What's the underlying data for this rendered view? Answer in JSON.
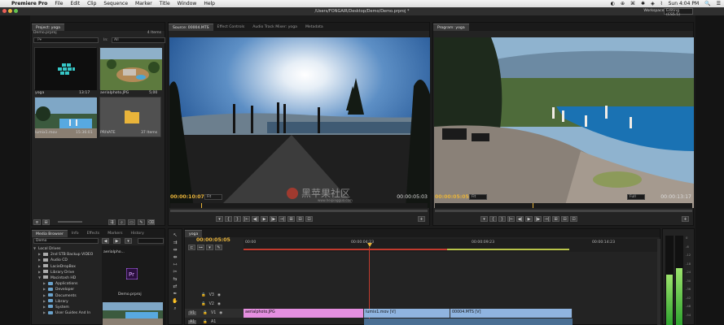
{
  "menubar": {
    "apple": "",
    "app": "Premiere Pro",
    "items": [
      "File",
      "Edit",
      "Clip",
      "Sequence",
      "Marker",
      "Title",
      "Window",
      "Help"
    ],
    "right": [
      "◐",
      "⊕",
      "⌘",
      "✱",
      "◈",
      "⌇",
      "Sun 4:04 PM",
      "🔍",
      "☰"
    ]
  },
  "titlebar": {
    "path": "/Users/FONGAIR/Desktop/Demo/Demo.prproj *",
    "workspace_label": "Workspace:",
    "workspace_value": "Editing (CS5.5)"
  },
  "project": {
    "tabs": [
      "Project: yoga"
    ],
    "subtitle": "Demo.prproj",
    "count": "4 Items",
    "search_placeholder": "P▾",
    "in_label": "In:",
    "in_value": "All",
    "items": [
      {
        "name": "yoga",
        "meta": "13:17"
      },
      {
        "name": "aerialphoto.JPG",
        "meta": "5;00"
      },
      {
        "name": "lumix1.mov",
        "meta": "15:36:01"
      },
      {
        "name": "PRIVATE",
        "meta": "37 Items"
      }
    ]
  },
  "source": {
    "tabs": [
      "Source: 00004.MTS",
      "Effect Controls",
      "Audio Track Mixer: yoga",
      "Metadata"
    ],
    "tc_left": "00:00:10:07",
    "fit": "Fit",
    "tc_right": "00:00:05:03",
    "controls": [
      "▾",
      "{",
      "}",
      "|←",
      "◀|",
      "▶",
      "|▶",
      "→|",
      "⊞",
      "⊟",
      "⊡",
      "+"
    ]
  },
  "program": {
    "tabs": [
      "Program: yoga"
    ],
    "tc_left": "00:00:05:05",
    "fit": "Fit",
    "quality": "Full",
    "tc_right": "00:00:13:17",
    "controls": [
      "▾",
      "{",
      "}",
      "|←",
      "◀|",
      "▶",
      "|▶",
      "→|",
      "⊞",
      "⊟",
      "⊡",
      "+"
    ]
  },
  "media": {
    "tabs": [
      "Media Browser",
      "Info",
      "Effects",
      "Markers",
      "History"
    ],
    "location": "Demo",
    "tree": [
      {
        "label": "Local Drives",
        "level": 0,
        "type": "none"
      },
      {
        "label": "2nd STB Backup VIDEO",
        "level": 1,
        "type": "disk"
      },
      {
        "label": "Audio CD",
        "level": 1,
        "type": "disk"
      },
      {
        "label": "LacieDropBox",
        "level": 1,
        "type": "disk"
      },
      {
        "label": "Library Drive",
        "level": 1,
        "type": "disk"
      },
      {
        "label": "Macintosh HD",
        "level": 1,
        "type": "disk"
      },
      {
        "label": "Applications",
        "level": 2,
        "type": "folder"
      },
      {
        "label": "Developer",
        "level": 2,
        "type": "folder"
      },
      {
        "label": "Documents",
        "level": 2,
        "type": "folder"
      },
      {
        "label": "Library",
        "level": 2,
        "type": "folder"
      },
      {
        "label": "System",
        "level": 2,
        "type": "folder"
      },
      {
        "label": "User Guides And In",
        "level": 2,
        "type": "folder"
      }
    ],
    "thumbs": [
      "aerialpho...",
      "Demo.prproj"
    ]
  },
  "timeline": {
    "tab": "yoga",
    "timecode": "00:00:05:05",
    "ruler": [
      "00:00",
      "00:00:04:23",
      "00:00:09:23",
      "00:00:14:23"
    ],
    "tracks": [
      "V3",
      "V2",
      "V1",
      "A1"
    ],
    "clips": [
      {
        "label": "aerialphoto.JPG",
        "color": "#e58fe0"
      },
      {
        "label": "lumix1.mov [V]",
        "color": "#8fb4e0"
      },
      {
        "label": "00004.MTS [V]",
        "color": "#8fb4e0"
      }
    ]
  },
  "meters": {
    "scale": [
      "0",
      "-6",
      "-12",
      "-18",
      "-24",
      "-30",
      "-36",
      "-42",
      "-48",
      "-54"
    ]
  },
  "watermark": "黑苹果社区",
  "watermark_url": "www.heipingguo.com"
}
